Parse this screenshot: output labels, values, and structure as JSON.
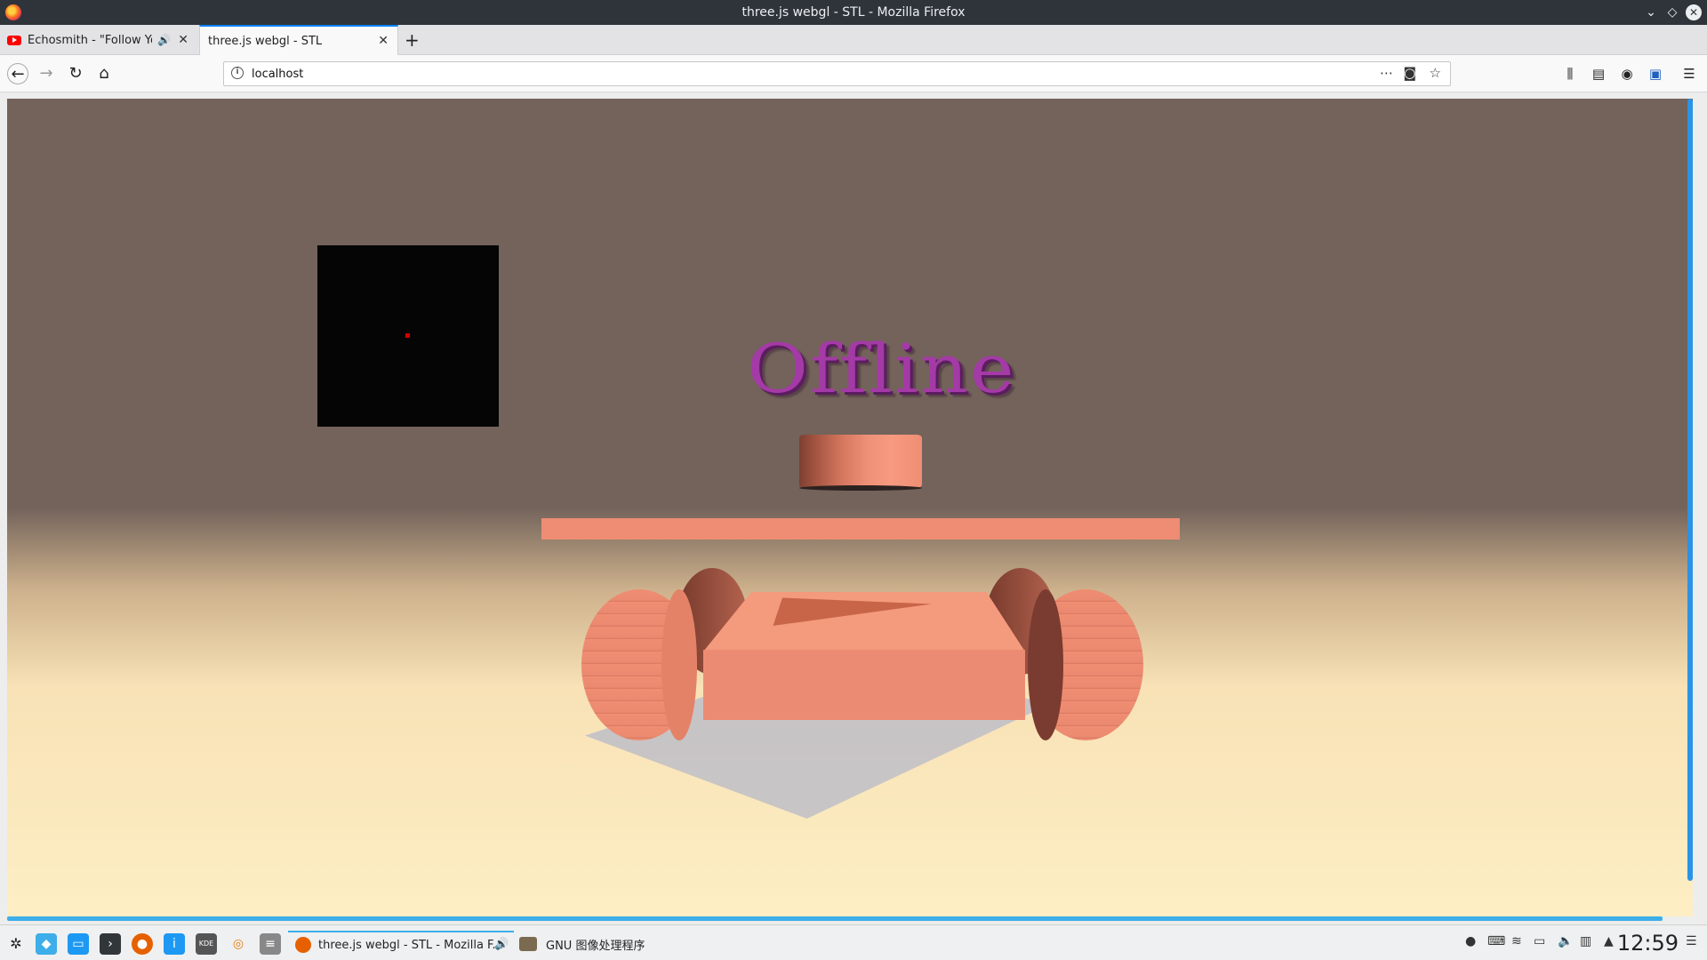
{
  "window": {
    "title": "three.js webgl - STL - Mozilla Firefox"
  },
  "tabs": [
    {
      "label": "Echosmith - \"Follow You\"",
      "icon": "youtube-icon",
      "audio": "speaker-icon"
    },
    {
      "label": "three.js webgl - STL",
      "active": true
    }
  ],
  "nav": {
    "url": "localhost"
  },
  "scene": {
    "text": "Offline"
  },
  "taskbar": {
    "tasks": [
      {
        "label": "three.js webgl - STL - Mozilla F...",
        "icon": "firefox-icon"
      },
      {
        "label": "GNU 图像处理程序",
        "icon": "gimp-icon"
      }
    ],
    "clock": "12:59"
  },
  "colors": {
    "accent": "#0a84ff",
    "scene_bg": "#73635a",
    "model": "#ee8c74",
    "text3d": "#a43aa6",
    "taskbar_accent": "#3daee9"
  }
}
